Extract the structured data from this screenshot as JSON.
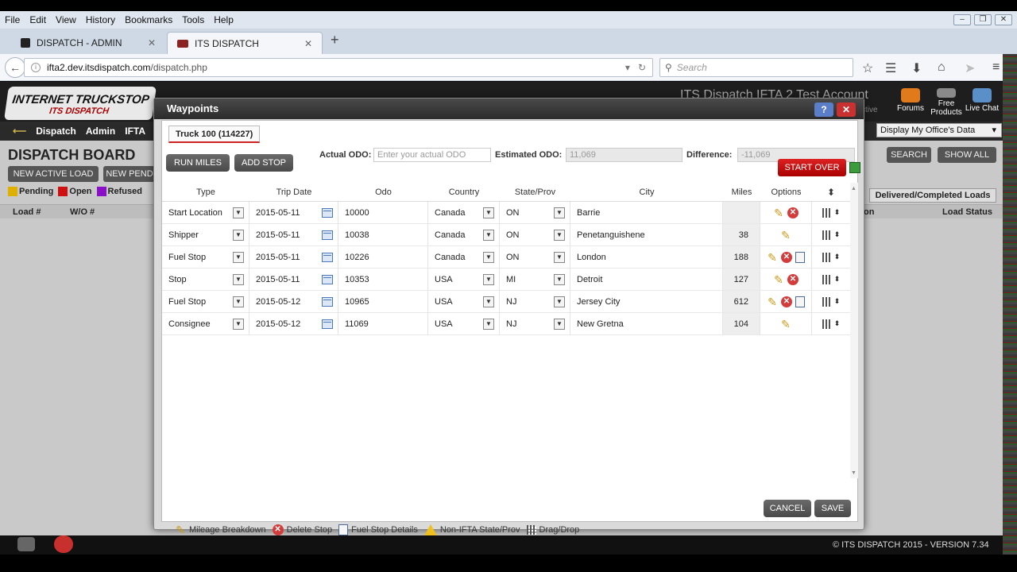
{
  "browser": {
    "menu": [
      "File",
      "Edit",
      "View",
      "History",
      "Bookmarks",
      "Tools",
      "Help"
    ],
    "tabs": [
      {
        "title": "DISPATCH - ADMIN"
      },
      {
        "title": "ITS DISPATCH"
      }
    ],
    "url_host": "ifta2.dev.itsdispatch.com",
    "url_path": "/dispatch.php",
    "search_placeholder": "Search"
  },
  "app": {
    "logo_line1": "INTERNET TRUCKSTOP",
    "logo_line2": "ITS DISPATCH",
    "account_title": "ITS Dispatch IFTA 2 Test Account",
    "account_sub": "ctive",
    "header_links": [
      "Forums",
      "Free Products",
      "Live Chat"
    ],
    "nav": [
      "Dispatch",
      "Admin",
      "IFTA"
    ],
    "office_select": "Display My Office's Data",
    "board_title": "DISPATCH BOARD",
    "new_active_load": "NEW ACTIVE LOAD",
    "new_pending": "NEW PEND",
    "legend": [
      {
        "label": "Pending",
        "color": "#e0b000"
      },
      {
        "label": "Open",
        "color": "#d01010"
      },
      {
        "label": "Refused",
        "color": "#8a10c8"
      }
    ],
    "left_cols": [
      "Load #",
      "W/O #"
    ],
    "right_tab": "Delivered/Completed Loads",
    "right_cols": [
      "ion",
      "Load Status"
    ],
    "search_btn": "SEARCH",
    "showall_btn": "SHOW ALL",
    "footer": "© ITS DISPATCH 2015  -  VERSION 7.34"
  },
  "dialog": {
    "title": "Waypoints",
    "help": "?",
    "close": "✕",
    "truck_tab": "Truck 100 (114227)",
    "run_miles": "RUN MILES",
    "add_stop": "ADD STOP",
    "actual_odo_label": "Actual ODO:",
    "actual_odo_placeholder": "Enter your actual ODO",
    "estimated_odo_label": "Estimated ODO:",
    "estimated_odo_value": "11,069",
    "difference_label": "Difference:",
    "difference_value": "-11,069",
    "start_over": "START OVER",
    "columns": [
      "Type",
      "Trip Date",
      "Odo",
      "Country",
      "State/Prov",
      "City",
      "Miles",
      "Options"
    ],
    "rows": [
      {
        "type": "Start Location",
        "date": "2015-05-11",
        "odo": "10000",
        "country": "Canada",
        "state": "ON",
        "city": "Barrie",
        "miles": "",
        "options": [
          "edit",
          "delete"
        ]
      },
      {
        "type": "Shipper",
        "date": "2015-05-11",
        "odo": "10038",
        "country": "Canada",
        "state": "ON",
        "city": "Penetanguishene",
        "miles": "38",
        "options": [
          "edit"
        ]
      },
      {
        "type": "Fuel Stop",
        "date": "2015-05-11",
        "odo": "10226",
        "country": "Canada",
        "state": "ON",
        "city": "London",
        "miles": "188",
        "options": [
          "edit",
          "delete",
          "fuel"
        ]
      },
      {
        "type": "Stop",
        "date": "2015-05-11",
        "odo": "10353",
        "country": "USA",
        "state": "MI",
        "city": "Detroit",
        "miles": "127",
        "options": [
          "edit",
          "delete"
        ]
      },
      {
        "type": "Fuel Stop",
        "date": "2015-05-12",
        "odo": "10965",
        "country": "USA",
        "state": "NJ",
        "city": "Jersey City",
        "miles": "612",
        "options": [
          "edit",
          "delete",
          "fuel"
        ]
      },
      {
        "type": "Consignee",
        "date": "2015-05-12",
        "odo": "11069",
        "country": "USA",
        "state": "NJ",
        "city": "New Gretna",
        "miles": "104",
        "options": [
          "edit"
        ]
      }
    ],
    "legend_mileage": "Mileage Breakdown",
    "legend_delete": "Delete Stop",
    "legend_fuel": "Fuel Stop Details",
    "legend_nonifta": "Non-IFTA State/Prov",
    "legend_drag": "Drag/Drop",
    "cancel": "CANCEL",
    "save": "SAVE"
  }
}
